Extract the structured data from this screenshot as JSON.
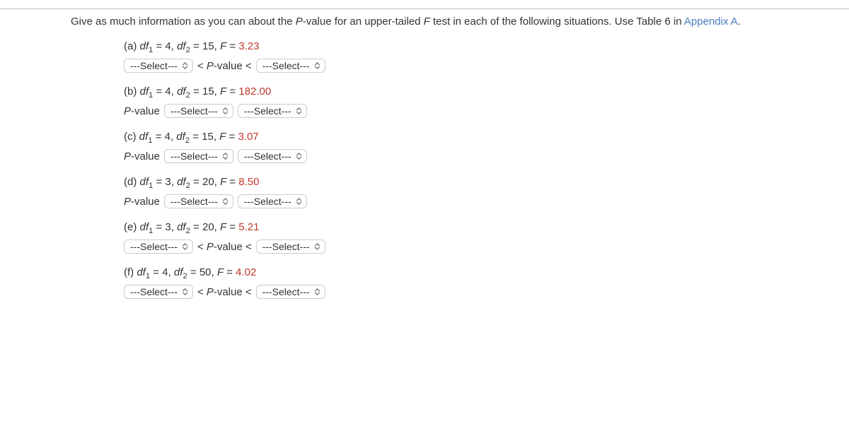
{
  "intro": {
    "pre_link": "Give as much information as you can about the ",
    "pvalue": "P",
    "mid1": "-value for an upper-tailed ",
    "fletter": "F",
    "mid2": " test in each of the following situations. Use Table 6 in ",
    "link": "Appendix A",
    "post_link": "."
  },
  "parts": {
    "a": {
      "label": "(a)",
      "df1": "4",
      "df2": "15",
      "F": "3.23",
      "layout": "bounded"
    },
    "b": {
      "label": "(b)",
      "df1": "4",
      "df2": "15",
      "F": "182.00",
      "layout": "prefix"
    },
    "c": {
      "label": "(c)",
      "df1": "4",
      "df2": "15",
      "F": "3.07",
      "layout": "prefix"
    },
    "d": {
      "label": "(d)",
      "df1": "3",
      "df2": "20",
      "F": "8.50",
      "layout": "prefix"
    },
    "e": {
      "label": "(e)",
      "df1": "3",
      "df2": "20",
      "F": "5.21",
      "layout": "bounded"
    },
    "f": {
      "label": "(f)",
      "df1": "4",
      "df2": "50",
      "F": "4.02",
      "layout": "bounded"
    }
  },
  "strings": {
    "select_placeholder": "---Select---",
    "pvalue_label": "P-value",
    "lt_pvalue_lt": "< P-value <",
    "df_eq": " = ",
    "comma": ", ",
    "F_eq": "F = "
  }
}
